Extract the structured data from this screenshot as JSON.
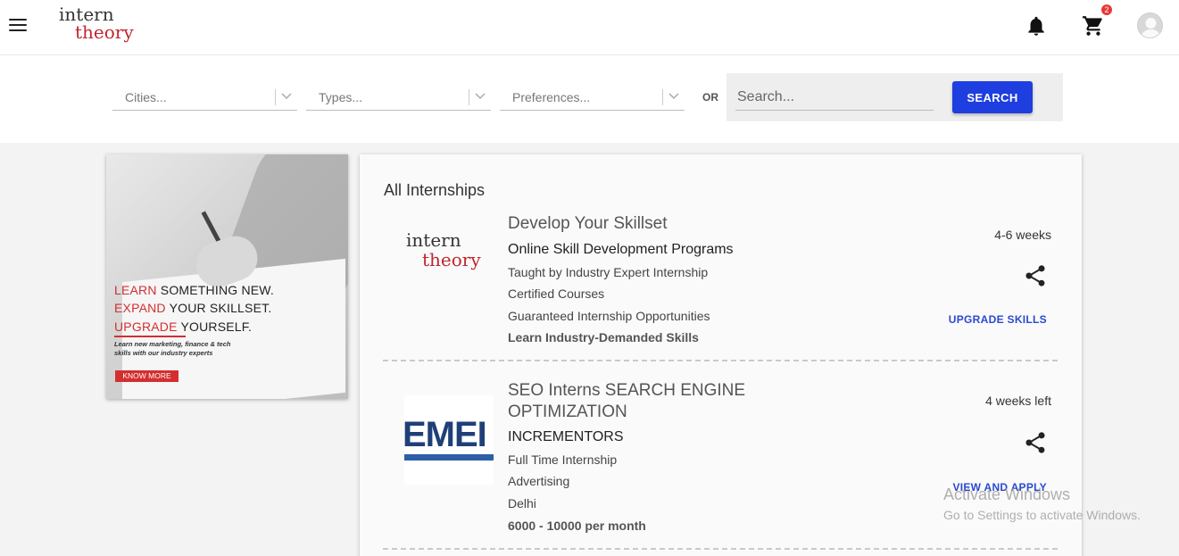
{
  "header": {
    "logo": {
      "line1": "intern",
      "line2": "theory"
    },
    "cart_count": "2"
  },
  "filters": {
    "cities_placeholder": "Cities...",
    "types_placeholder": "Types...",
    "preferences_placeholder": "Preferences...",
    "or_label": "OR",
    "search_placeholder": "Search...",
    "search_button": "SEARCH"
  },
  "banner": {
    "line1_red": "LEARN",
    "line1_rest": " SOMETHING NEW.",
    "line2_red": "EXPAND",
    "line2_rest": " YOUR SKILLSET.",
    "line3_red": "UPGRADE",
    "line3_rest": " YOURSELF.",
    "sub1": "Learn new marketing, finance & tech",
    "sub2": "skills with our industry experts",
    "cta": "KNOW MORE"
  },
  "listing": {
    "title": "All Internships",
    "cards": [
      {
        "title": "Develop Your Skillset",
        "company": "Online Skill Development Programs",
        "meta": [
          "Taught by Industry Expert Internship",
          "Certified Courses",
          "Guaranteed Internship Opportunities"
        ],
        "highlight": "Learn Industry-Demanded Skills",
        "duration": "4-6 weeks",
        "action": "UPGRADE SKILLS",
        "logo_line1": "intern",
        "logo_line2": "theory"
      },
      {
        "title": "SEO Interns SEARCH ENGINE OPTIMIZATION",
        "company": "INCREMENTORS",
        "meta": [
          "Full Time Internship",
          "Advertising",
          "Delhi"
        ],
        "highlight": "6000 - 10000 per month",
        "duration": "4 weeks left",
        "action": "VIEW AND APPLY",
        "logo_text": "EMEI"
      }
    ]
  },
  "watermark": {
    "line1": "Activate Windows",
    "line2": "Go to Settings to activate Windows."
  },
  "colors": {
    "accent_blue": "#1e3ee0",
    "brand_red": "#c0262d",
    "link_blue": "#2a4ad0"
  }
}
